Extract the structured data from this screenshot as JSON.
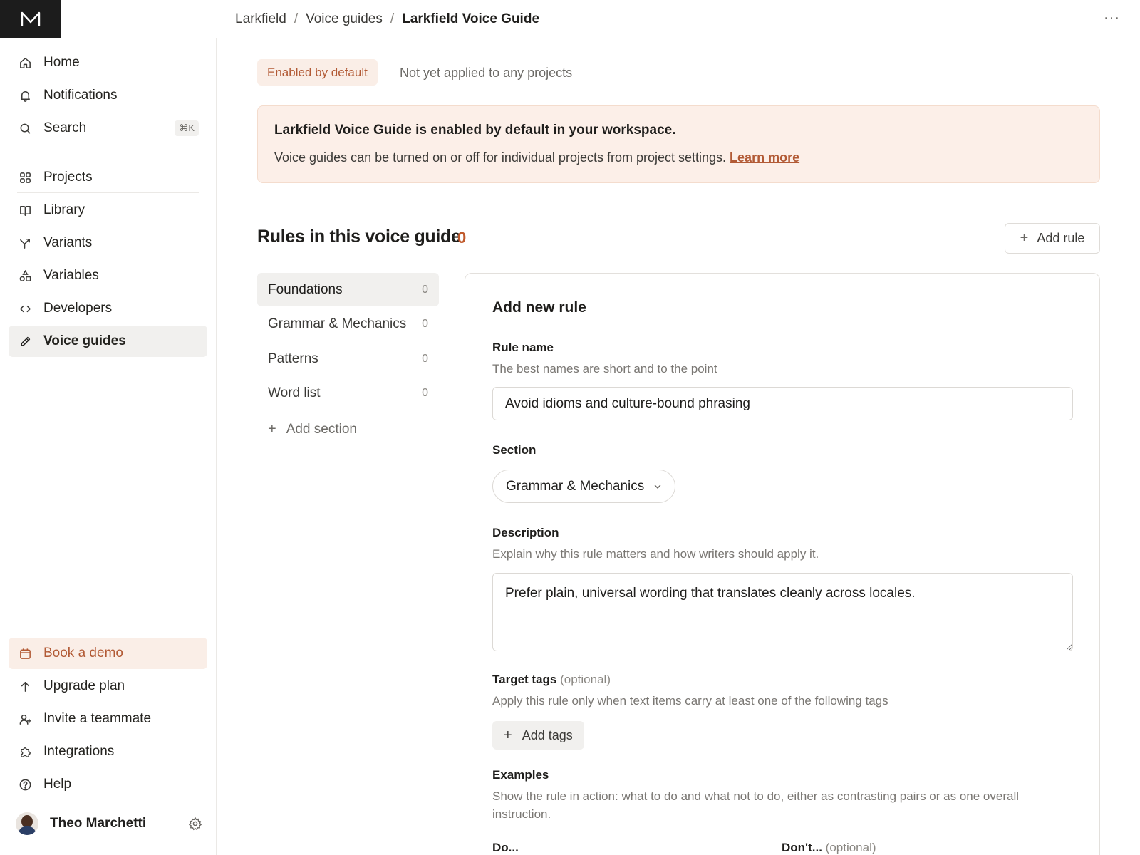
{
  "breadcrumb": {
    "root": "Larkfield",
    "parent": "Voice guides",
    "current": "Larkfield Voice Guide",
    "separator": "/"
  },
  "topbar": {
    "more_icon": "more-horizontal-icon",
    "more_text": "···"
  },
  "sidebar": {
    "items": [
      {
        "label": "Home",
        "icon": "home-icon"
      },
      {
        "label": "Notifications",
        "icon": "bell-icon"
      },
      {
        "label": "Search",
        "icon": "search-icon",
        "shortcut": "⌘K"
      },
      {
        "label": "Projects",
        "icon": "grid-icon"
      },
      {
        "label": "Library",
        "icon": "book-icon"
      },
      {
        "label": "Variants",
        "icon": "branch-icon"
      },
      {
        "label": "Variables",
        "icon": "shapes-icon"
      },
      {
        "label": "Developers",
        "icon": "code-icon"
      },
      {
        "label": "Voice guides",
        "icon": "pen-icon",
        "active": true
      }
    ],
    "bottom_items": [
      {
        "label": "Book a demo",
        "icon": "calendar-icon"
      },
      {
        "label": "Upgrade plan",
        "icon": "arrow-up-icon"
      },
      {
        "label": "Invite a teammate",
        "icon": "user-plus-icon"
      },
      {
        "label": "Integrations",
        "icon": "puzzle-icon"
      },
      {
        "label": "Help",
        "icon": "help-circle-icon"
      }
    ],
    "user": {
      "name": "Theo Marchetti"
    }
  },
  "status": {
    "badge": "Enabled by default",
    "applied": "Not yet applied to any projects"
  },
  "banner": {
    "title": "Larkfield Voice Guide is enabled by default in your workspace.",
    "text": "Voice guides can be turned on or off for individual projects from project settings.",
    "link": "Learn more"
  },
  "rules": {
    "heading": "Rules in this voice guide",
    "count": "0",
    "add_rule": "Add rule",
    "sections": [
      {
        "label": "Foundations",
        "count": "0",
        "active": true
      },
      {
        "label": "Grammar & Mechanics",
        "count": "0"
      },
      {
        "label": "Patterns",
        "count": "0"
      },
      {
        "label": "Word list",
        "count": "0"
      }
    ],
    "add_section": "Add section"
  },
  "form": {
    "title": "Add new rule",
    "rule_name": {
      "label": "Rule name",
      "hint": "The best names are short and to the point",
      "value": "Avoid idioms and culture-bound phrasing"
    },
    "section": {
      "label": "Section",
      "value": "Grammar & Mechanics"
    },
    "description": {
      "label": "Description",
      "hint": "Explain why this rule matters and how writers should apply it.",
      "value": "Prefer plain, universal wording that translates cleanly across locales."
    },
    "tags": {
      "label": "Target tags",
      "optional": "(optional)",
      "hint": "Apply this rule only when text items carry at least one of the following tags",
      "button": "Add tags"
    },
    "examples": {
      "label": "Examples",
      "hint_line1": "Show the rule in action: what to do and what not to do, either as contrasting pairs or as one overall",
      "hint_line2": "instruction.",
      "do_label": "Do...",
      "dont_label": "Don't...",
      "dont_optional": "(optional)"
    }
  },
  "colors": {
    "accent": "#b25a35",
    "badge_bg": "#faeee7",
    "banner_bg": "#fcefe8",
    "sidebar_active": "#f1f0ee"
  }
}
